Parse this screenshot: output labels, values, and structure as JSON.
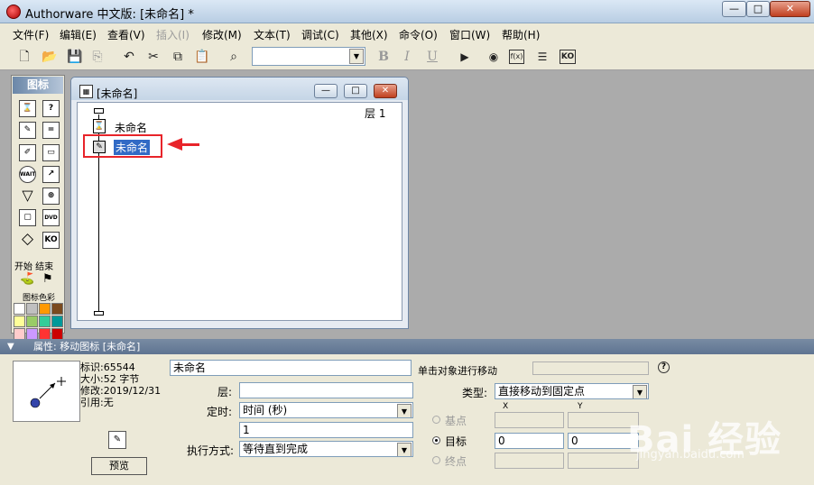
{
  "window": {
    "title": "Authorware 中文版: [未命名] *",
    "min": "—",
    "max": "□",
    "close": "✕"
  },
  "menu": [
    {
      "label": "文件(F)",
      "enabled": true
    },
    {
      "label": "编辑(E)",
      "enabled": true
    },
    {
      "label": "查看(V)",
      "enabled": true
    },
    {
      "label": "插入(I)",
      "enabled": false
    },
    {
      "label": "修改(M)",
      "enabled": true
    },
    {
      "label": "文本(T)",
      "enabled": true
    },
    {
      "label": "调试(C)",
      "enabled": true
    },
    {
      "label": "其他(X)",
      "enabled": true
    },
    {
      "label": "命令(O)",
      "enabled": true
    },
    {
      "label": "窗口(W)",
      "enabled": true
    },
    {
      "label": "帮助(H)",
      "enabled": true
    }
  ],
  "toolbar": {
    "icons": [
      "new-file-icon",
      "open-file-icon",
      "save-all-icon",
      "import-icon",
      "undo-icon",
      "cut-icon",
      "copy-icon",
      "paste-icon",
      "find-icon"
    ],
    "font_combo_value": "",
    "bold": "B",
    "italic": "I",
    "underline": "U",
    "right_icons": [
      "restart-icon",
      "control-panel-icon",
      "functions-icon",
      "variables-icon",
      "knowledge-objects-icon"
    ],
    "fn_label": "f(x)",
    "ko_label": "KO"
  },
  "palette": {
    "title": "图标",
    "icons": [
      {
        "name": "display-icon",
        "glyph": "⌛"
      },
      {
        "name": "motion-icon",
        "glyph": "?"
      },
      {
        "name": "erase-icon",
        "glyph": "✎"
      },
      {
        "name": "wait-icon",
        "glyph": "="
      },
      {
        "name": "navigate-icon",
        "glyph": "✐"
      },
      {
        "name": "framework-icon",
        "glyph": "▭"
      },
      {
        "name": "decision-icon",
        "glyph": "WAIT"
      },
      {
        "name": "interaction-icon",
        "glyph": "↗"
      },
      {
        "name": "calculation-icon",
        "glyph": "▽"
      },
      {
        "name": "map-icon",
        "glyph": "⊕"
      },
      {
        "name": "movie-icon",
        "glyph": "▢"
      },
      {
        "name": "sound-icon",
        "glyph": "DVD"
      },
      {
        "name": "video-icon",
        "glyph": "◇"
      },
      {
        "name": "ko-icon",
        "glyph": "KO"
      }
    ],
    "start_end_label": "开始 结束",
    "color_label": "图标色彩",
    "colors": [
      "#ffffff",
      "#c0c0c0",
      "#ff9900",
      "#7a4a1e",
      "#ffff99",
      "#99cc66",
      "#33cc99",
      "#009999",
      "#ffcccc",
      "#cc99ff",
      "#ff3333",
      "#cc0000"
    ]
  },
  "design_window": {
    "title": "[未命名]",
    "layer": "层 1",
    "nodes": [
      {
        "label": "未命名",
        "type": "display",
        "selected": false
      },
      {
        "label": "未命名",
        "type": "motion",
        "selected": true
      }
    ]
  },
  "properties": {
    "header": "属性: 移动图标 [未命名]",
    "info": {
      "id": "标识:65544",
      "size": "大小:52 字节",
      "modified": "修改:2019/12/31",
      "ref": "引用:无"
    },
    "preview_button": "预览",
    "name_value": "未命名",
    "layer_label": "层:",
    "layer_value": "",
    "timing_label": "定时:",
    "timing_value": "时间 (秒)",
    "timing_amount": "1",
    "exec_label": "执行方式:",
    "exec_value": "等待直到完成",
    "hint": "单击对象进行移动",
    "type_label": "类型:",
    "type_value": "直接移动到固定点",
    "col_x": "X",
    "col_y": "Y",
    "base_label": "基点",
    "target_label": "目标",
    "end_label": "终点",
    "target_x": "0",
    "target_y": "0",
    "help": "?"
  },
  "watermark": {
    "text": "Bai 经验",
    "url": "jingyan.baidu.com"
  }
}
